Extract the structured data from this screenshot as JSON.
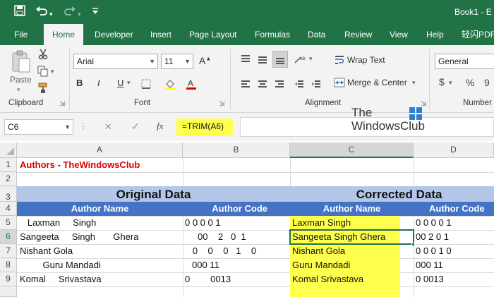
{
  "titlebar": {
    "title": "Book1 - E",
    "save_icon": "save-icon",
    "undo_icon": "undo-icon",
    "redo_icon": "redo-icon",
    "customize_icon": "customize-icon"
  },
  "tabs": [
    "File",
    "Home",
    "Developer",
    "Insert",
    "Page Layout",
    "Formulas",
    "Data",
    "Review",
    "View",
    "Help",
    "轻闪PDF"
  ],
  "ribbon": {
    "clipboard": {
      "paste_label": "Paste",
      "group_label": "Clipboard"
    },
    "font": {
      "font_name": "Arial",
      "font_size": "11",
      "bold": "B",
      "italic": "I",
      "underline": "U",
      "group_label": "Font"
    },
    "alignment": {
      "wrap_text": "Wrap Text",
      "merge_center": "Merge & Center",
      "group_label": "Alignment"
    },
    "number": {
      "format": "General",
      "currency": "$",
      "percent": "%",
      "comma": "9",
      "group_label": "Number"
    }
  },
  "formula_bar": {
    "name_box": "C6",
    "cancel": "✕",
    "enter": "✓",
    "fx": "fx",
    "formula": "=TRIM(A6)"
  },
  "watermark": {
    "line1": "The",
    "line2": "WindowsClub"
  },
  "columns": [
    "A",
    "B",
    "C",
    "D"
  ],
  "rows": [
    "1",
    "2",
    "3",
    "4",
    "5",
    "6",
    "7",
    "8",
    "9"
  ],
  "sheet": {
    "a1": "Authors - TheWindowsClub",
    "original_title": "Original Data",
    "corrected_title": "Corrected Data",
    "header_author_name": "Author Name",
    "header_author_code": "Author Code",
    "original": [
      {
        "name": "   Laxman     Singh",
        "code": "0 0 0 0 1"
      },
      {
        "name": "Sangeeta     Singh       Ghera",
        "code": "     00    2   0  1"
      },
      {
        "name": "Nishant Gola",
        "code": "   0    0    0   1    0"
      },
      {
        "name": "         Guru Mandadi",
        "code": "000 11"
      },
      {
        "name": "Komal     Srivastava",
        "code": "0        0013"
      }
    ],
    "corrected": [
      {
        "name": "Laxman Singh",
        "code": "0 0 0 0 1"
      },
      {
        "name": "Sangeeta Singh Ghera",
        "code": "00 2 0 1"
      },
      {
        "name": "Nishant Gola",
        "code": "0 0 0 1 0"
      },
      {
        "name": "Guru Mandadi",
        "code": "000 11"
      },
      {
        "name": "Komal Srivastava",
        "code": "0 0013"
      }
    ]
  },
  "colors": {
    "excel_green": "#217346",
    "header_band": "#b4c6e7",
    "header_row": "#4472c4",
    "highlight": "#ffff66",
    "a1_red": "#e00000"
  }
}
